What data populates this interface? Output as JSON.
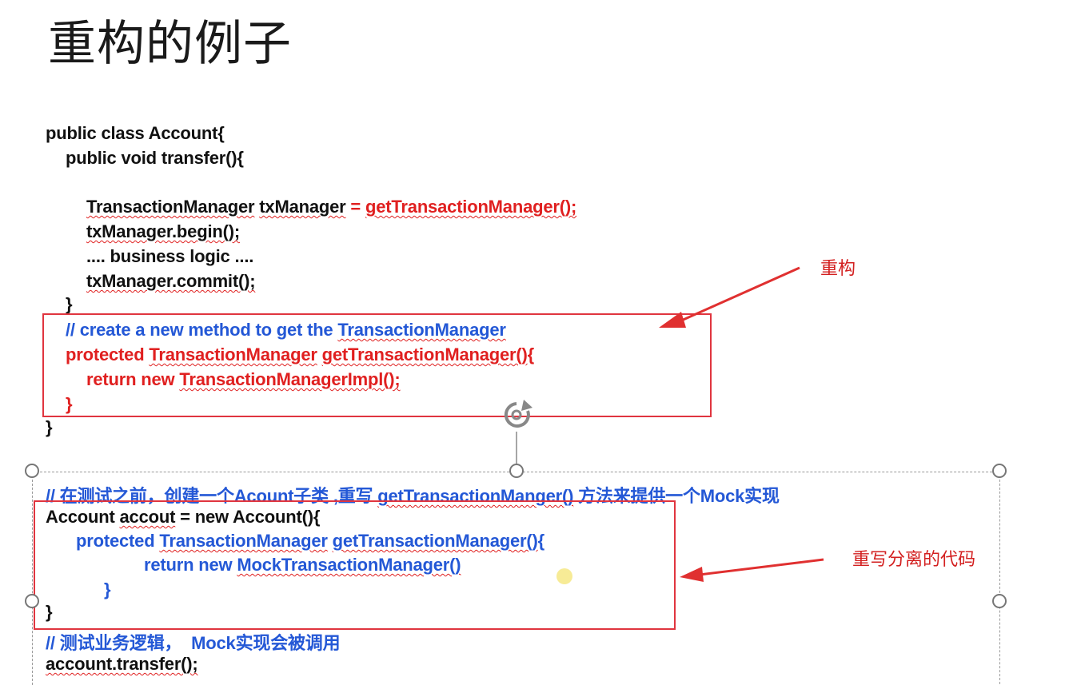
{
  "slide": {
    "title": "重构的例子"
  },
  "code_top": {
    "line1": "public class Account{",
    "line2": "public void transfer(){",
    "line3_a": "TransactionManager",
    "line3_b": " ",
    "line3_c": "txManager",
    "line3_d": " = ",
    "line3_e": "getTransactionManager();",
    "line4": "txManager.begin();",
    "line5": ".... business logic ....",
    "line6": "txManager.commit();",
    "line7": "}",
    "line8_a": "// create a new method to get the ",
    "line8_b": "TransactionManager",
    "line9_a": "protected ",
    "line9_b": "TransactionManager",
    "line9_c": " ",
    "line9_d": "getTransactionManager()",
    "line9_e": "{",
    "line10_a": "return new ",
    "line10_b": "TransactionManagerImpl();",
    "line11": "}",
    "line12": "}"
  },
  "code_bottom": {
    "comment1_a": "// 在测试之前，创建一个Acount子类 ,重写 ",
    "comment1_b": "getTransactionManger()",
    "comment1_c": " 方法来提供一个Mock实现",
    "line1_a": "Account ",
    "line1_b": "accout",
    "line1_c": " = new Account(){",
    "line2_a": "protected ",
    "line2_b": "TransactionManager",
    "line2_c": " ",
    "line2_d": "getTransactionManager()",
    "line2_e": "{",
    "line3_a": "return new ",
    "line3_b": "MockTransactionManager()",
    "line4": "}",
    "line5": "}",
    "comment2": "// 测试业务逻辑，  Mock实现会被调用",
    "line6": "account.transfer();"
  },
  "annotations": {
    "refactor": "重构",
    "override": "重写分离的代码"
  },
  "colors": {
    "code_red": "#e02020",
    "code_blue": "#2458d6",
    "box_red": "#e0353f",
    "arrow_red": "#e03030"
  }
}
